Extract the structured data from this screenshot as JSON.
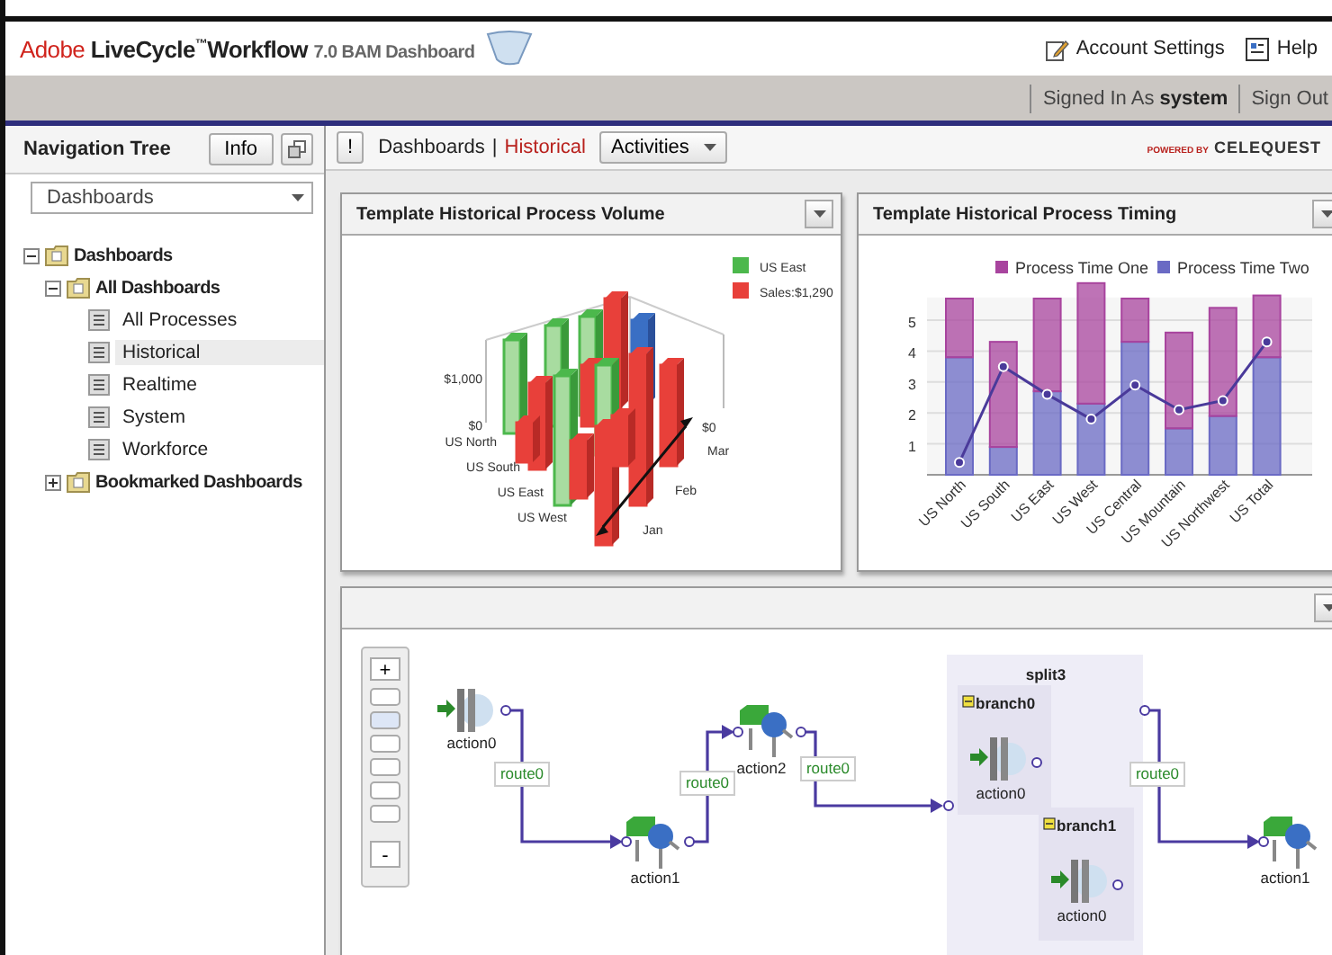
{
  "header": {
    "logo": {
      "brand": "Adobe",
      "product": "LiveCycle",
      "mark": "™",
      "name": "Workflow",
      "version": "7.0 BAM Dashboard"
    },
    "links": [
      {
        "kind": "settings",
        "label": "Account Settings"
      },
      {
        "kind": "help",
        "label": "Help"
      }
    ]
  },
  "session": {
    "signed_in": "Signed In As **system**",
    "sign_out": "Sign Out"
  },
  "sidebar": {
    "title": "Navigation Tree",
    "info_button": "Info",
    "dropdown": "Dashboards",
    "tree": [
      {
        "label": "Dashboards",
        "kind": "folder",
        "expanded": true,
        "children": [
          {
            "label": "All Dashboards",
            "kind": "folder",
            "expanded": true,
            "children": [
              {
                "label": "All Processes",
                "kind": "page",
                "selected": false
              },
              {
                "label": "Historical",
                "kind": "page",
                "selected": true
              },
              {
                "label": "Realtime",
                "kind": "page",
                "selected": false
              },
              {
                "label": "System",
                "kind": "page",
                "selected": false
              },
              {
                "label": "Workforce",
                "kind": "page",
                "selected": false
              }
            ]
          },
          {
            "label": "Bookmarked Dashboards",
            "kind": "folder",
            "expanded": false
          }
        ]
      }
    ]
  },
  "toolbar": {
    "alert_button": "!",
    "breadcrumb": [
      {
        "label": "Dashboards",
        "selected": false
      },
      {
        "label": "Historical",
        "selected": true
      }
    ],
    "separator": "|",
    "activities": "Activities",
    "powered_by": "POWERED BY",
    "vendor": "CELEQUEST"
  },
  "volume_panel": {
    "title": "Template Historical Process Volume",
    "legend": [
      {
        "label": "US East",
        "color": "#4cb84c"
      },
      {
        "label": "Sales:$1,290",
        "color": "#e8403a"
      }
    ],
    "y_labels": [
      "$1,000",
      "$0"
    ],
    "regions": [
      "US North",
      "US South",
      "US East",
      "US West"
    ],
    "depth_label": "$0",
    "months": [
      "Mar",
      "Feb",
      "Jan"
    ]
  },
  "timing_panel": {
    "title": "Template Historical Process Timing",
    "chart_data": {
      "type": "bar",
      "stacked": true,
      "categories": [
        "US North",
        "US South",
        "US East",
        "US West",
        "US Central",
        "US Mountain",
        "US Northwest",
        "US Total"
      ],
      "yticks": [
        1,
        2,
        3,
        4,
        5
      ],
      "ylim": [
        0,
        6.2
      ],
      "grid": true,
      "legend": "top",
      "series": [
        {
          "name": "Process Time Two",
          "type": "bar",
          "color": "#6a6ac4",
          "values": [
            3.8,
            0.9,
            2.7,
            2.3,
            4.3,
            1.5,
            1.9,
            3.8
          ]
        },
        {
          "name": "Process Time One",
          "type": "bar",
          "color": "#a8449e",
          "values": [
            1.9,
            3.4,
            3.0,
            3.9,
            1.4,
            3.1,
            3.5,
            2.0
          ]
        },
        {
          "type": "line",
          "marker": "o",
          "color": "#4a3a9a",
          "values": [
            0.4,
            3.5,
            2.6,
            1.8,
            2.9,
            2.1,
            2.4,
            4.3
          ]
        }
      ]
    }
  },
  "process_panel": {
    "zoom_in": "+",
    "zoom_out": "-",
    "nodes": [
      {
        "kind": "pillar",
        "label": "action0"
      },
      {
        "kind": "query",
        "label": "action1"
      },
      {
        "kind": "query",
        "label": "action2"
      },
      {
        "kind": "query",
        "label": "action1"
      }
    ],
    "routes": [
      "route0",
      "route0",
      "route0",
      "route0"
    ],
    "split": {
      "label": "split3",
      "branches": [
        {
          "label": "branch0",
          "node": {
            "kind": "pillar",
            "label": "action0"
          }
        },
        {
          "label": "branch1",
          "node": {
            "kind": "pillar",
            "label": "action0"
          }
        }
      ]
    }
  }
}
